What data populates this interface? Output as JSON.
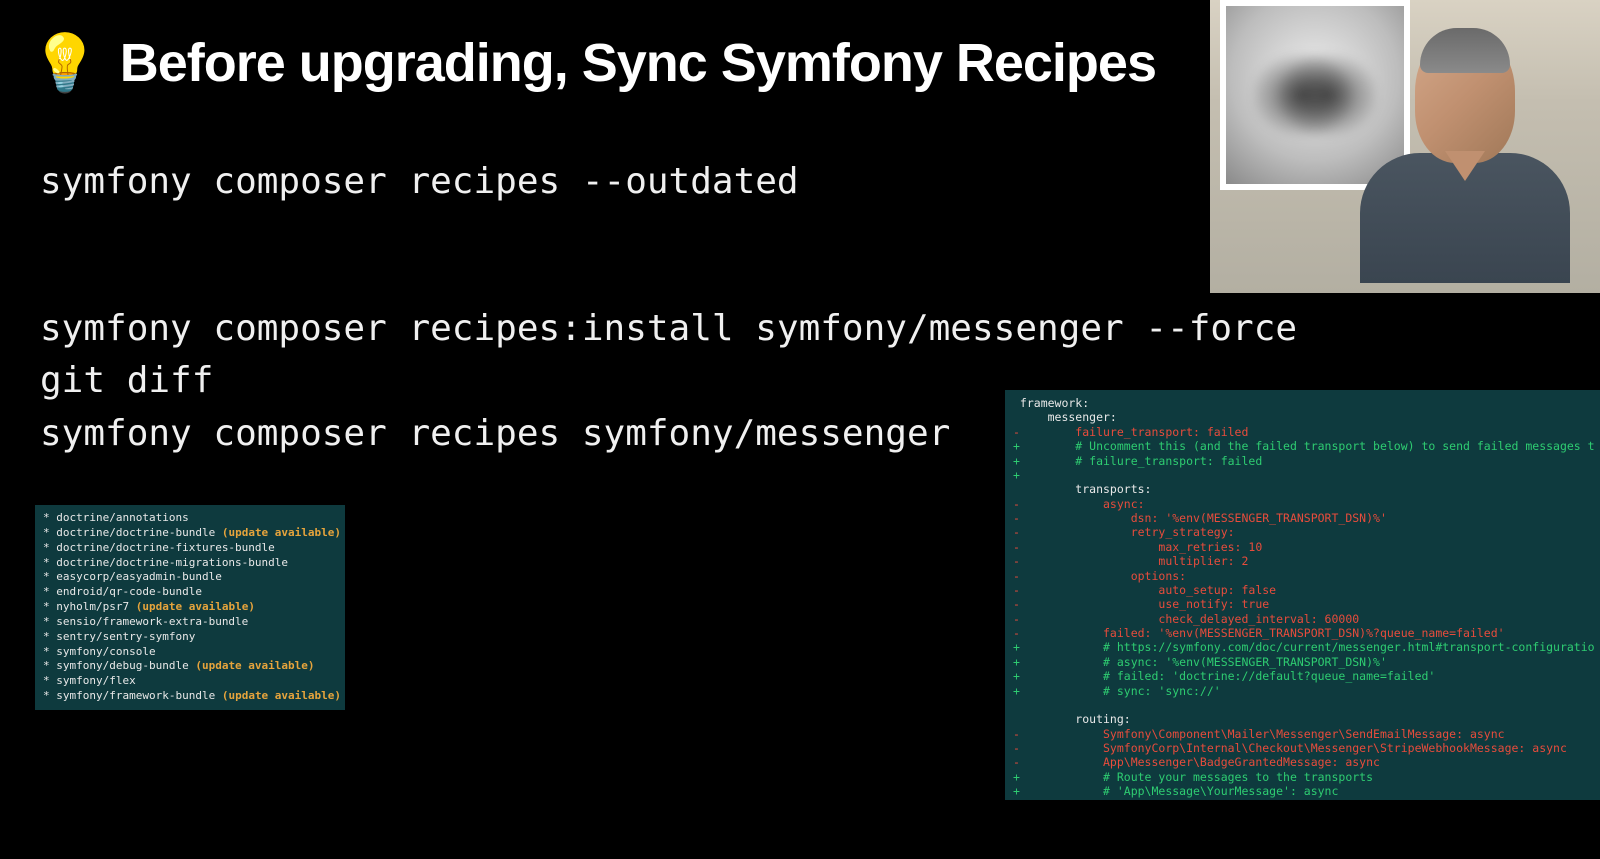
{
  "title": "Before upgrading, Sync Symfony Recipes",
  "icon": "💡",
  "commands": {
    "block1": [
      "symfony composer recipes --outdated"
    ],
    "block2": [
      "symfony composer recipes:install symfony/messenger --force",
      "git diff",
      "symfony composer recipes symfony/messenger"
    ]
  },
  "recipes_list": [
    {
      "name": "doctrine/annotations",
      "update": false
    },
    {
      "name": "doctrine/doctrine-bundle",
      "update": true
    },
    {
      "name": "doctrine/doctrine-fixtures-bundle",
      "update": false
    },
    {
      "name": "doctrine/doctrine-migrations-bundle",
      "update": false
    },
    {
      "name": "easycorp/easyadmin-bundle",
      "update": false
    },
    {
      "name": "endroid/qr-code-bundle",
      "update": false
    },
    {
      "name": "nyholm/psr7",
      "update": true
    },
    {
      "name": "sensio/framework-extra-bundle",
      "update": false
    },
    {
      "name": "sentry/sentry-symfony",
      "update": false
    },
    {
      "name": "symfony/console",
      "update": false
    },
    {
      "name": "symfony/debug-bundle",
      "update": true
    },
    {
      "name": "symfony/flex",
      "update": false
    },
    {
      "name": "symfony/framework-bundle",
      "update": true
    }
  ],
  "update_label": "(update available)",
  "diff": [
    {
      "t": "ctx",
      "text": " framework:"
    },
    {
      "t": "ctx",
      "text": "     messenger:"
    },
    {
      "t": "del",
      "text": "-        failure_transport: failed"
    },
    {
      "t": "add",
      "text": "+        # Uncomment this (and the failed transport below) to send failed messages t"
    },
    {
      "t": "add",
      "text": "+        # failure_transport: failed"
    },
    {
      "t": "add",
      "text": "+"
    },
    {
      "t": "ctx",
      "text": "         transports:"
    },
    {
      "t": "del",
      "text": "-            async:"
    },
    {
      "t": "del",
      "text": "-                dsn: '%env(MESSENGER_TRANSPORT_DSN)%'"
    },
    {
      "t": "del",
      "text": "-                retry_strategy:"
    },
    {
      "t": "del",
      "text": "-                    max_retries: 10"
    },
    {
      "t": "del",
      "text": "-                    multiplier: 2"
    },
    {
      "t": "del",
      "text": "-                options:"
    },
    {
      "t": "del",
      "text": "-                    auto_setup: false"
    },
    {
      "t": "del",
      "text": "-                    use_notify: true"
    },
    {
      "t": "del",
      "text": "-                    check_delayed_interval: 60000"
    },
    {
      "t": "del",
      "text": "-            failed: '%env(MESSENGER_TRANSPORT_DSN)%?queue_name=failed'"
    },
    {
      "t": "add",
      "text": "+            # https://symfony.com/doc/current/messenger.html#transport-configuratio"
    },
    {
      "t": "add",
      "text": "+            # async: '%env(MESSENGER_TRANSPORT_DSN)%'"
    },
    {
      "t": "add",
      "text": "+            # failed: 'doctrine://default?queue_name=failed'"
    },
    {
      "t": "add",
      "text": "+            # sync: 'sync://'"
    },
    {
      "t": "ctx",
      "text": " "
    },
    {
      "t": "ctx",
      "text": "         routing:"
    },
    {
      "t": "del",
      "text": "-            Symfony\\Component\\Mailer\\Messenger\\SendEmailMessage: async"
    },
    {
      "t": "del",
      "text": "-            SymfonyCorp\\Internal\\Checkout\\Messenger\\StripeWebhookMessage: async"
    },
    {
      "t": "del",
      "text": "-            App\\Messenger\\BadgeGrantedMessage: async"
    },
    {
      "t": "add",
      "text": "+            # Route your messages to the transports"
    },
    {
      "t": "add",
      "text": "+            # 'App\\Message\\YourMessage': async"
    }
  ]
}
